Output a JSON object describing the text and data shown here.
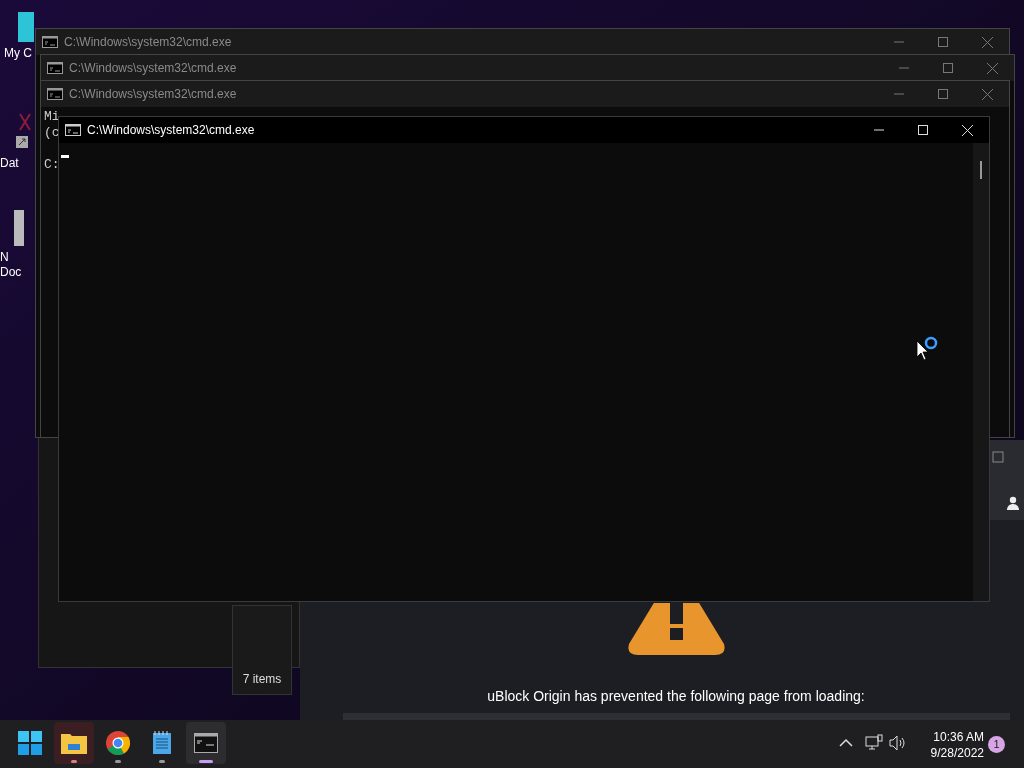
{
  "desktop_icons": [
    {
      "kind": "monitor",
      "lines": [
        "My C"
      ]
    },
    {
      "kind": "shortcut",
      "lines": [
        "Dat"
      ]
    },
    {
      "kind": "document",
      "lines": [
        "N",
        "Doc"
      ]
    }
  ],
  "windows": [
    {
      "title": "C:\\Windows\\system32\\cmd.exe",
      "active": false
    },
    {
      "title": "C:\\Windows\\system32\\cmd.exe",
      "active": false
    },
    {
      "title": "C:\\Windows\\system32\\cmd.exe",
      "active": false,
      "console_lines": [
        "Mi",
        "(c",
        "C:"
      ]
    },
    {
      "title": "C:\\Windows\\system32\\cmd.exe",
      "active": true
    }
  ],
  "explorer": {
    "status": "7 items"
  },
  "browser": {
    "message": "uBlock Origin has prevented the following page from loading:"
  },
  "taskbar": {
    "apps": [
      {
        "kind": "start",
        "running": false,
        "selected": false,
        "highlighted": false
      },
      {
        "kind": "explorer",
        "running": true,
        "selected": false,
        "highlighted": true
      },
      {
        "kind": "chrome",
        "running": true,
        "selected": false,
        "highlighted": false
      },
      {
        "kind": "notepad",
        "running": true,
        "selected": false,
        "highlighted": false
      },
      {
        "kind": "terminal",
        "running": true,
        "selected": true,
        "highlighted": false
      }
    ],
    "time": "10:36 AM",
    "date": "9/28/2022",
    "notification_count": "1"
  }
}
